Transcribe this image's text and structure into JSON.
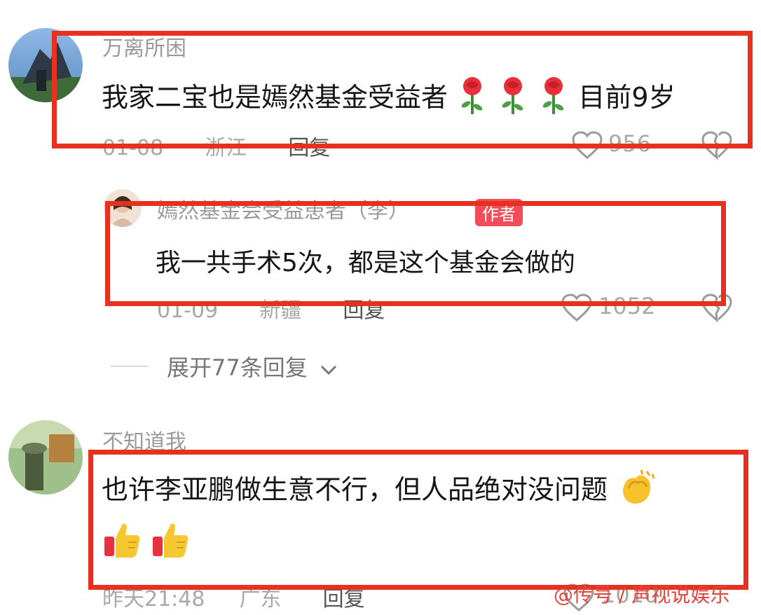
{
  "comments": [
    {
      "username": "万离所困",
      "text": "我家二宝也是嫣然基金受益者",
      "text_suffix": "目前9岁",
      "emojis": [
        "rose",
        "rose",
        "rose"
      ],
      "date": "01-08",
      "location": "浙江",
      "reply_label": "回复",
      "likes": "956"
    },
    {
      "username": "嫣然基金会受益患者（李）",
      "badge": "作者",
      "text": "我一共手术5次，都是这个基金会做的",
      "date": "01-09",
      "location": "新疆",
      "reply_label": "回复",
      "likes": "1052"
    },
    {
      "username": "不知道我",
      "text": "也许李亚鹏做生意不行，但人品绝对没问题",
      "emojis": [
        "clapping-hands",
        "thumbs-up",
        "thumbs-up"
      ],
      "date": "昨天21:48",
      "location": "广东",
      "reply_label": "回复",
      "likes": "1010"
    }
  ],
  "expand_replies": "展开77条回复",
  "watermark": "@传号 / 声视说娱乐",
  "colors": {
    "highlight_box": "#e8301f",
    "badge": "#f24b5a"
  }
}
